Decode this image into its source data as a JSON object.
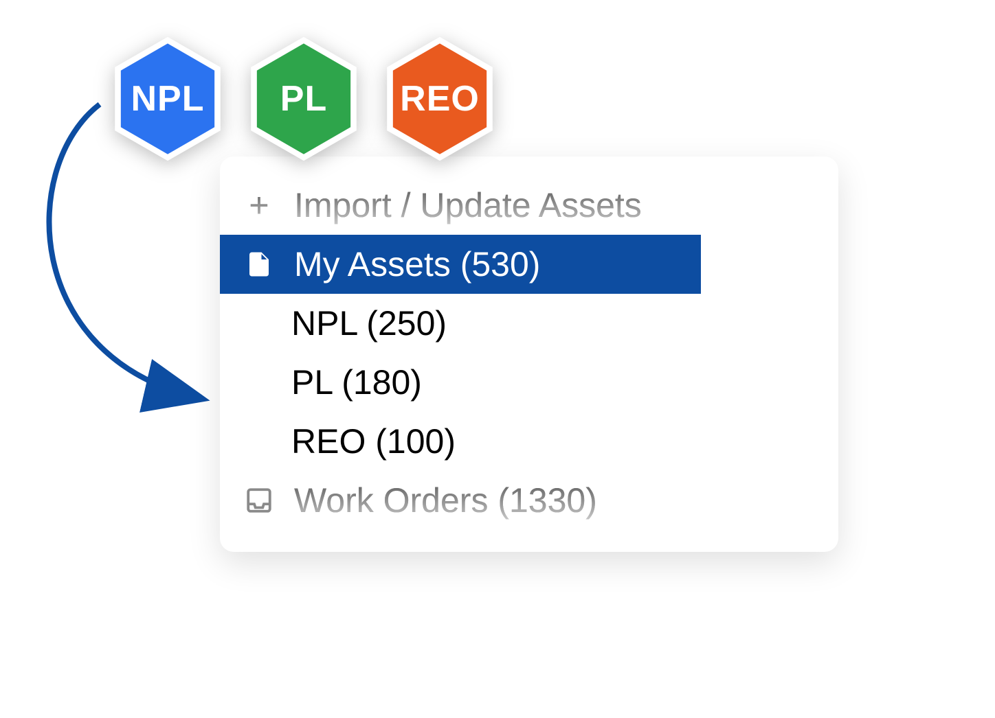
{
  "hexagons": [
    {
      "label": "NPL",
      "color": "#2b73f0"
    },
    {
      "label": "PL",
      "color": "#2ea54b"
    },
    {
      "label": "REO",
      "color": "#e95a1f"
    }
  ],
  "menu": {
    "import_label": "Import / Update Assets",
    "my_assets_label": "My Assets (530)",
    "categories": [
      {
        "label": "NPL (250)"
      },
      {
        "label": "PL (180)"
      },
      {
        "label": "REO (100)"
      }
    ],
    "work_orders_label": "Work Orders (1330)"
  },
  "colors": {
    "selected_bg": "#0d4da1",
    "arrow": "#0d4da1"
  }
}
